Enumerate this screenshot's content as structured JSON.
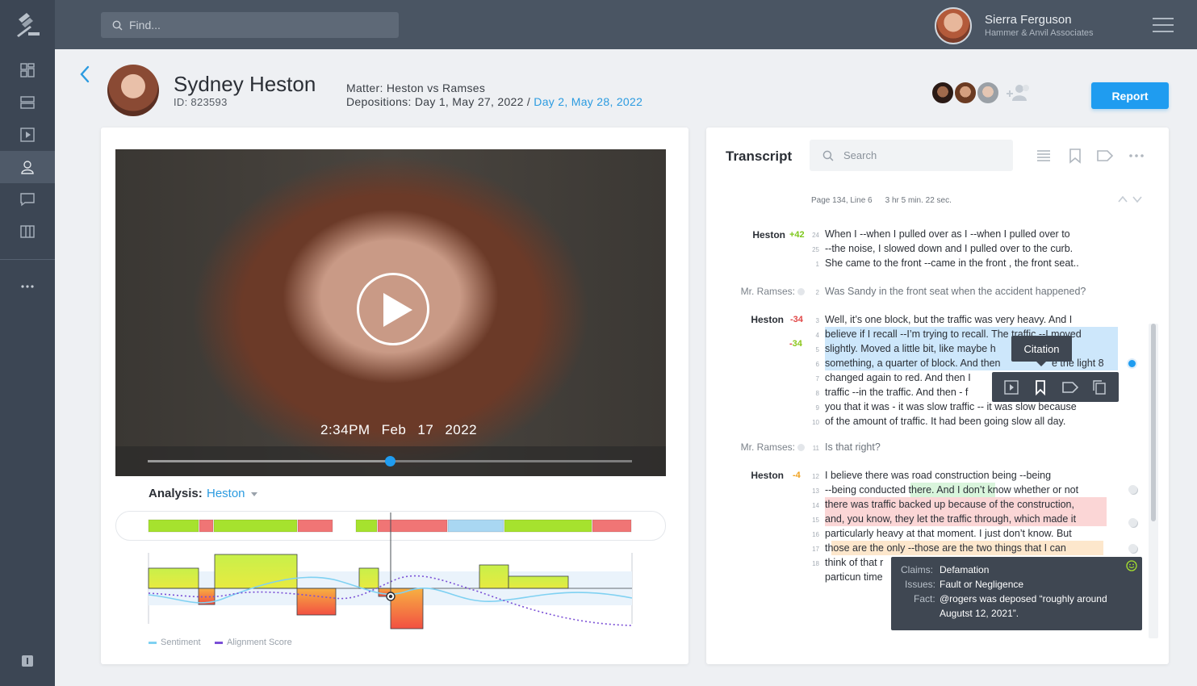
{
  "search": {
    "placeholder": "Find..."
  },
  "user": {
    "name": "Sierra Ferguson",
    "org": "Hammer & Anvil Associates"
  },
  "nav": {
    "items": [
      "dashboard-icon",
      "list-icon",
      "video-icon",
      "user-icon",
      "chat-icon",
      "columns-icon",
      "more-icon",
      "info-icon"
    ]
  },
  "subject": {
    "name": "Sydney Heston",
    "id": "ID: 823593"
  },
  "matter": {
    "label": "Matter: Heston vs Ramses"
  },
  "depositions": {
    "prefix": "Depositions: Day 1, May 27, 2022 / ",
    "link": "Day 2, May 28, 2022"
  },
  "report_label": "Report",
  "video": {
    "time": "2:34PM",
    "month": "Feb",
    "day": "17",
    "year": "2022",
    "progress": 0.5
  },
  "analysis": {
    "label": "Analysis:",
    "value": "Heston"
  },
  "legend": {
    "sentiment": "Sentiment",
    "alignment": "Alignment Score"
  },
  "colors": {
    "accent": "#1f9cf0",
    "positive": "#a6e22e",
    "negative": "#f07575",
    "neutral": "#a9d7f2",
    "sentiment_line": "#7fd1f2",
    "alignment_line": "#7a4fd6"
  },
  "transcript": {
    "title": "Transcript",
    "search_placeholder": "Search",
    "meta": {
      "page": "Page 134, Line 6",
      "duration": "3 hr 5 min. 22 sec."
    },
    "blocks": [
      {
        "speaker": "Heston",
        "score": "+42",
        "lines": [
          {
            "n": "24",
            "text": "When I --when I pulled over as I --when I pulled over to"
          },
          {
            "n": "25",
            "text": "--the noise, I slowed down and I pulled over to the curb."
          },
          {
            "n": "1",
            "text": "She came to the front --came in the front , the front  seat.."
          }
        ]
      },
      {
        "speaker": "Mr. Ramses:",
        "lines": [
          {
            "n": "2",
            "text": "Was Sandy in the front  seat when the accident happened?"
          }
        ]
      },
      {
        "speaker": "Heston",
        "score": "-34",
        "score2": "-34",
        "lines": [
          {
            "n": "3",
            "text": "Well, it’s one block, but the traffic was very heavy. And I"
          },
          {
            "n": "4",
            "text": "believe if I recall --I’m trying to recall. The traffic --I moved"
          },
          {
            "n": "5",
            "text": "slightly. Moved a little bit, like maybe h",
            "tail": "or"
          },
          {
            "n": "6",
            "text": "something, a quarter of block. And then",
            "tail": "e the light 8"
          },
          {
            "n": "7",
            "text": "changed again to red. And then I"
          },
          {
            "n": "8",
            "text": "traffic --in the  traffic. And then - f"
          },
          {
            "n": "9",
            "text": "you that it was - it was slow traffic -- it was slow because"
          },
          {
            "n": "10",
            "text": "of the amount of traffic. It had been going slow all day."
          }
        ]
      },
      {
        "speaker": "Mr. Ramses:",
        "lines": [
          {
            "n": "11",
            "text": "Is that right?"
          }
        ]
      },
      {
        "speaker": "Heston",
        "score": "-4",
        "lines": [
          {
            "n": "12",
            "text": "I believe there was road construction being --being"
          },
          {
            "n": "13",
            "text": "--being conducted there. And I don’t know whether or not"
          },
          {
            "n": "14",
            "text": "there was traffic backed up because of the construction,"
          },
          {
            "n": "15",
            "text": "and, you know, they let the traffic through, which made it"
          },
          {
            "n": "16",
            "text": "particularly heavy at that moment. I just don’t know. But"
          },
          {
            "n": "17",
            "text": "those are the only --those are the two things that I can"
          },
          {
            "n": "18",
            "text": "think of that r"
          },
          {
            "n": "",
            "text": "particun time"
          }
        ]
      }
    ],
    "tooltip": "Citation",
    "claims": {
      "claims_label": "Claims:",
      "claims_value": "Defamation",
      "issues_label": "Issues:",
      "issues_value": "Fault or Negligence",
      "fact_label": "Fact:",
      "fact_value_1": "@rogers was deposed “roughly around",
      "fact_value_2": "Augutst 12, 2021”."
    }
  },
  "chart_data": {
    "type": "bar",
    "bands": [
      {
        "tone": "positive"
      },
      {
        "tone": "negative"
      },
      {
        "tone": "positive"
      },
      {
        "tone": "negative"
      },
      {
        "tone": "positive"
      },
      {
        "tone": "negative"
      },
      {
        "tone": "neutral"
      },
      {
        "tone": "positive"
      },
      {
        "tone": "negative"
      }
    ],
    "steps": [
      25,
      -20,
      42,
      -33,
      0,
      25,
      -10,
      -50,
      0,
      29,
      15,
      0,
      -14
    ],
    "series": [
      {
        "name": "Sentiment"
      },
      {
        "name": "Alignment Score"
      }
    ]
  }
}
